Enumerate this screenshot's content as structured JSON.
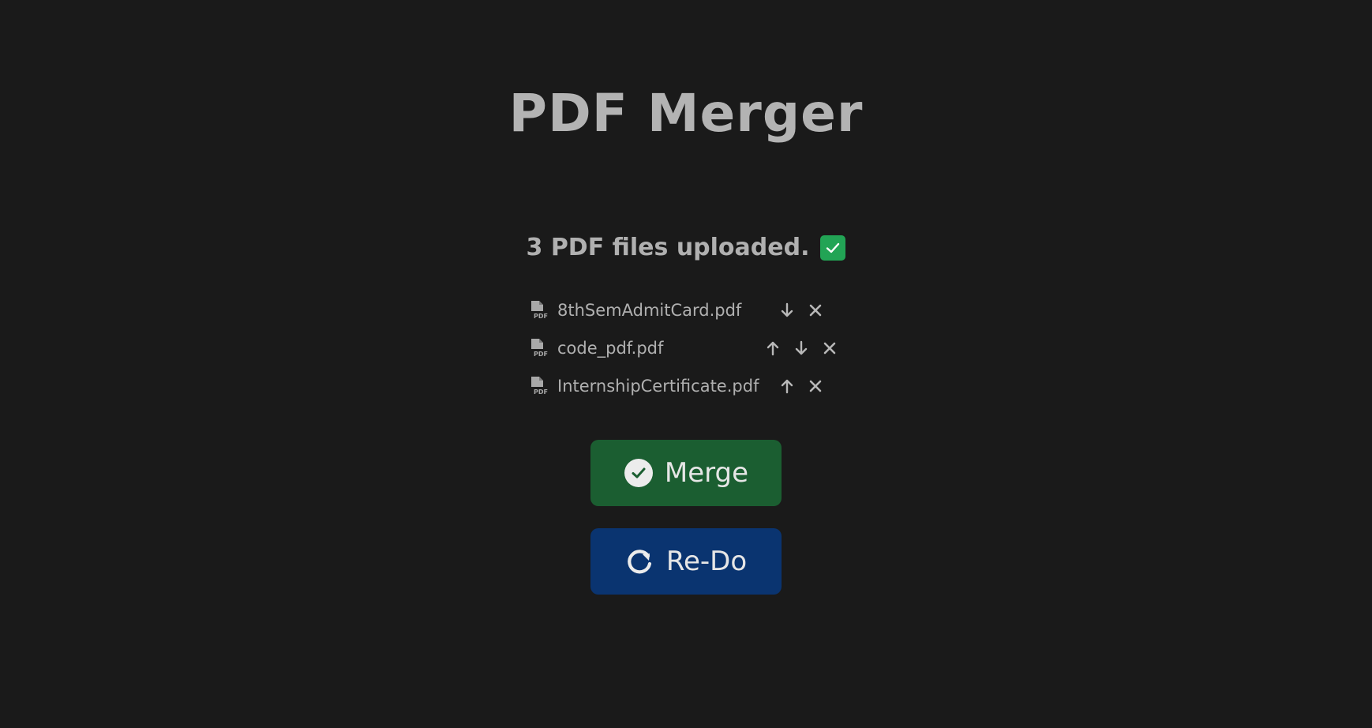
{
  "app": {
    "title": "PDF Merger"
  },
  "status": {
    "text": "3 PDF files uploaded.",
    "icon": "check-box-icon",
    "icon_color": "#22a455"
  },
  "files": [
    {
      "name": "8thSemAdmitCard.pdf",
      "actions": [
        "move-down",
        "remove"
      ]
    },
    {
      "name": "code_pdf.pdf",
      "actions": [
        "move-up",
        "move-down",
        "remove"
      ]
    },
    {
      "name": "InternshipCertificate.pdf",
      "actions": [
        "move-up",
        "remove"
      ]
    }
  ],
  "buttons": {
    "merge_label": "Merge",
    "merge_icon": "check-circle-icon",
    "merge_color": "#1b5e31",
    "redo_label": "Re-Do",
    "redo_icon": "redo-icon",
    "redo_color": "#0a3470"
  },
  "colors": {
    "background": "#1a1a1a",
    "text": "#b4b4b4"
  }
}
